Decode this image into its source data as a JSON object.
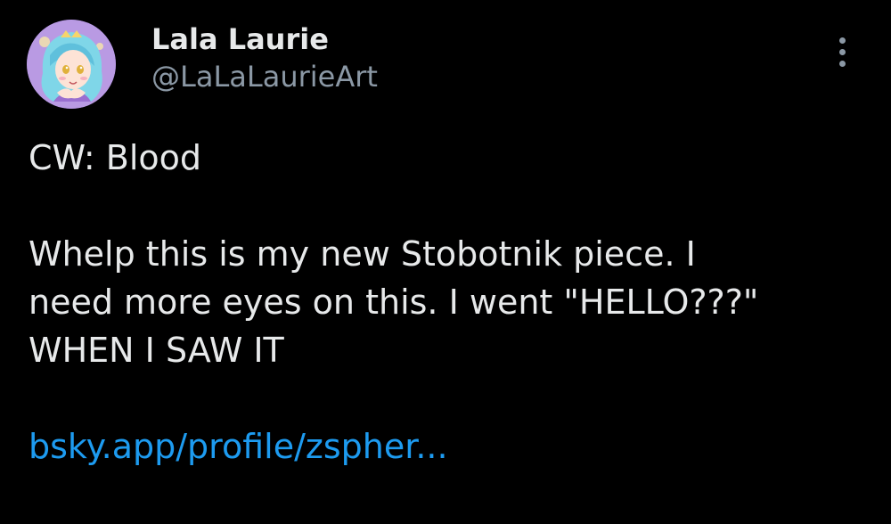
{
  "post": {
    "author": {
      "display_name": "Lala Laurie",
      "handle": "@LaLaLaurieArt",
      "avatar_icon": "avatar-image"
    },
    "more_icon": "more-vertical-icon",
    "content": {
      "line1": "CW: Blood",
      "line2": "Whelp this is my new Stobotnik piece. I",
      "line3": "need more eyes on this. I went \"HELLO???\"",
      "line4": "WHEN I SAW IT",
      "link_text": "bsky.app/profile/zspher..."
    }
  },
  "colors": {
    "background": "#000000",
    "text": "#e7e9ea",
    "secondary_text": "#8b98a5",
    "link": "#1d9bf0"
  }
}
